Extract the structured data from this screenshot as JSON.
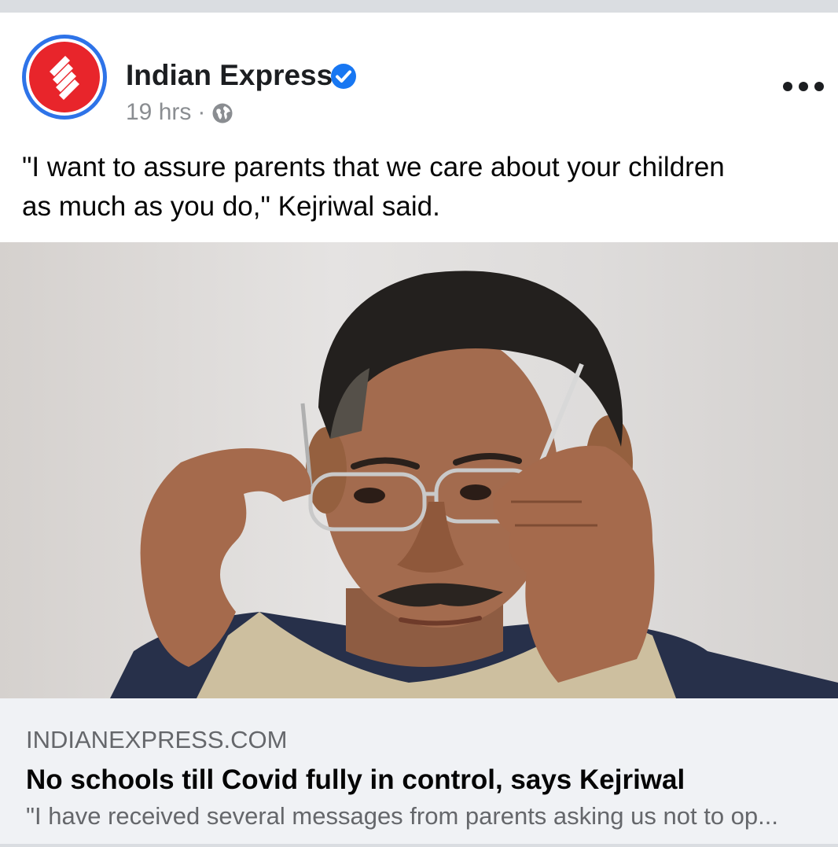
{
  "post": {
    "page_name": "Indian Express",
    "verified": true,
    "time": "19 hrs",
    "separator": "·",
    "audience_icon": "globe-icon",
    "more_icon": "more-options-icon",
    "caption": "\"I want to assure parents that we care about your children\nas much as you do,\" Kejriwal said."
  },
  "link_preview": {
    "domain": "INDIANEXPRESS.COM",
    "headline": "No schools till Covid fully in control, says Kejriwal",
    "description": "\"I have received several messages from parents asking us not to op..."
  },
  "colors": {
    "brand_red": "#e8252b",
    "avatar_ring": "#2e73e8",
    "verified_blue": "#1877f2",
    "secondary_text": "#65676b"
  }
}
